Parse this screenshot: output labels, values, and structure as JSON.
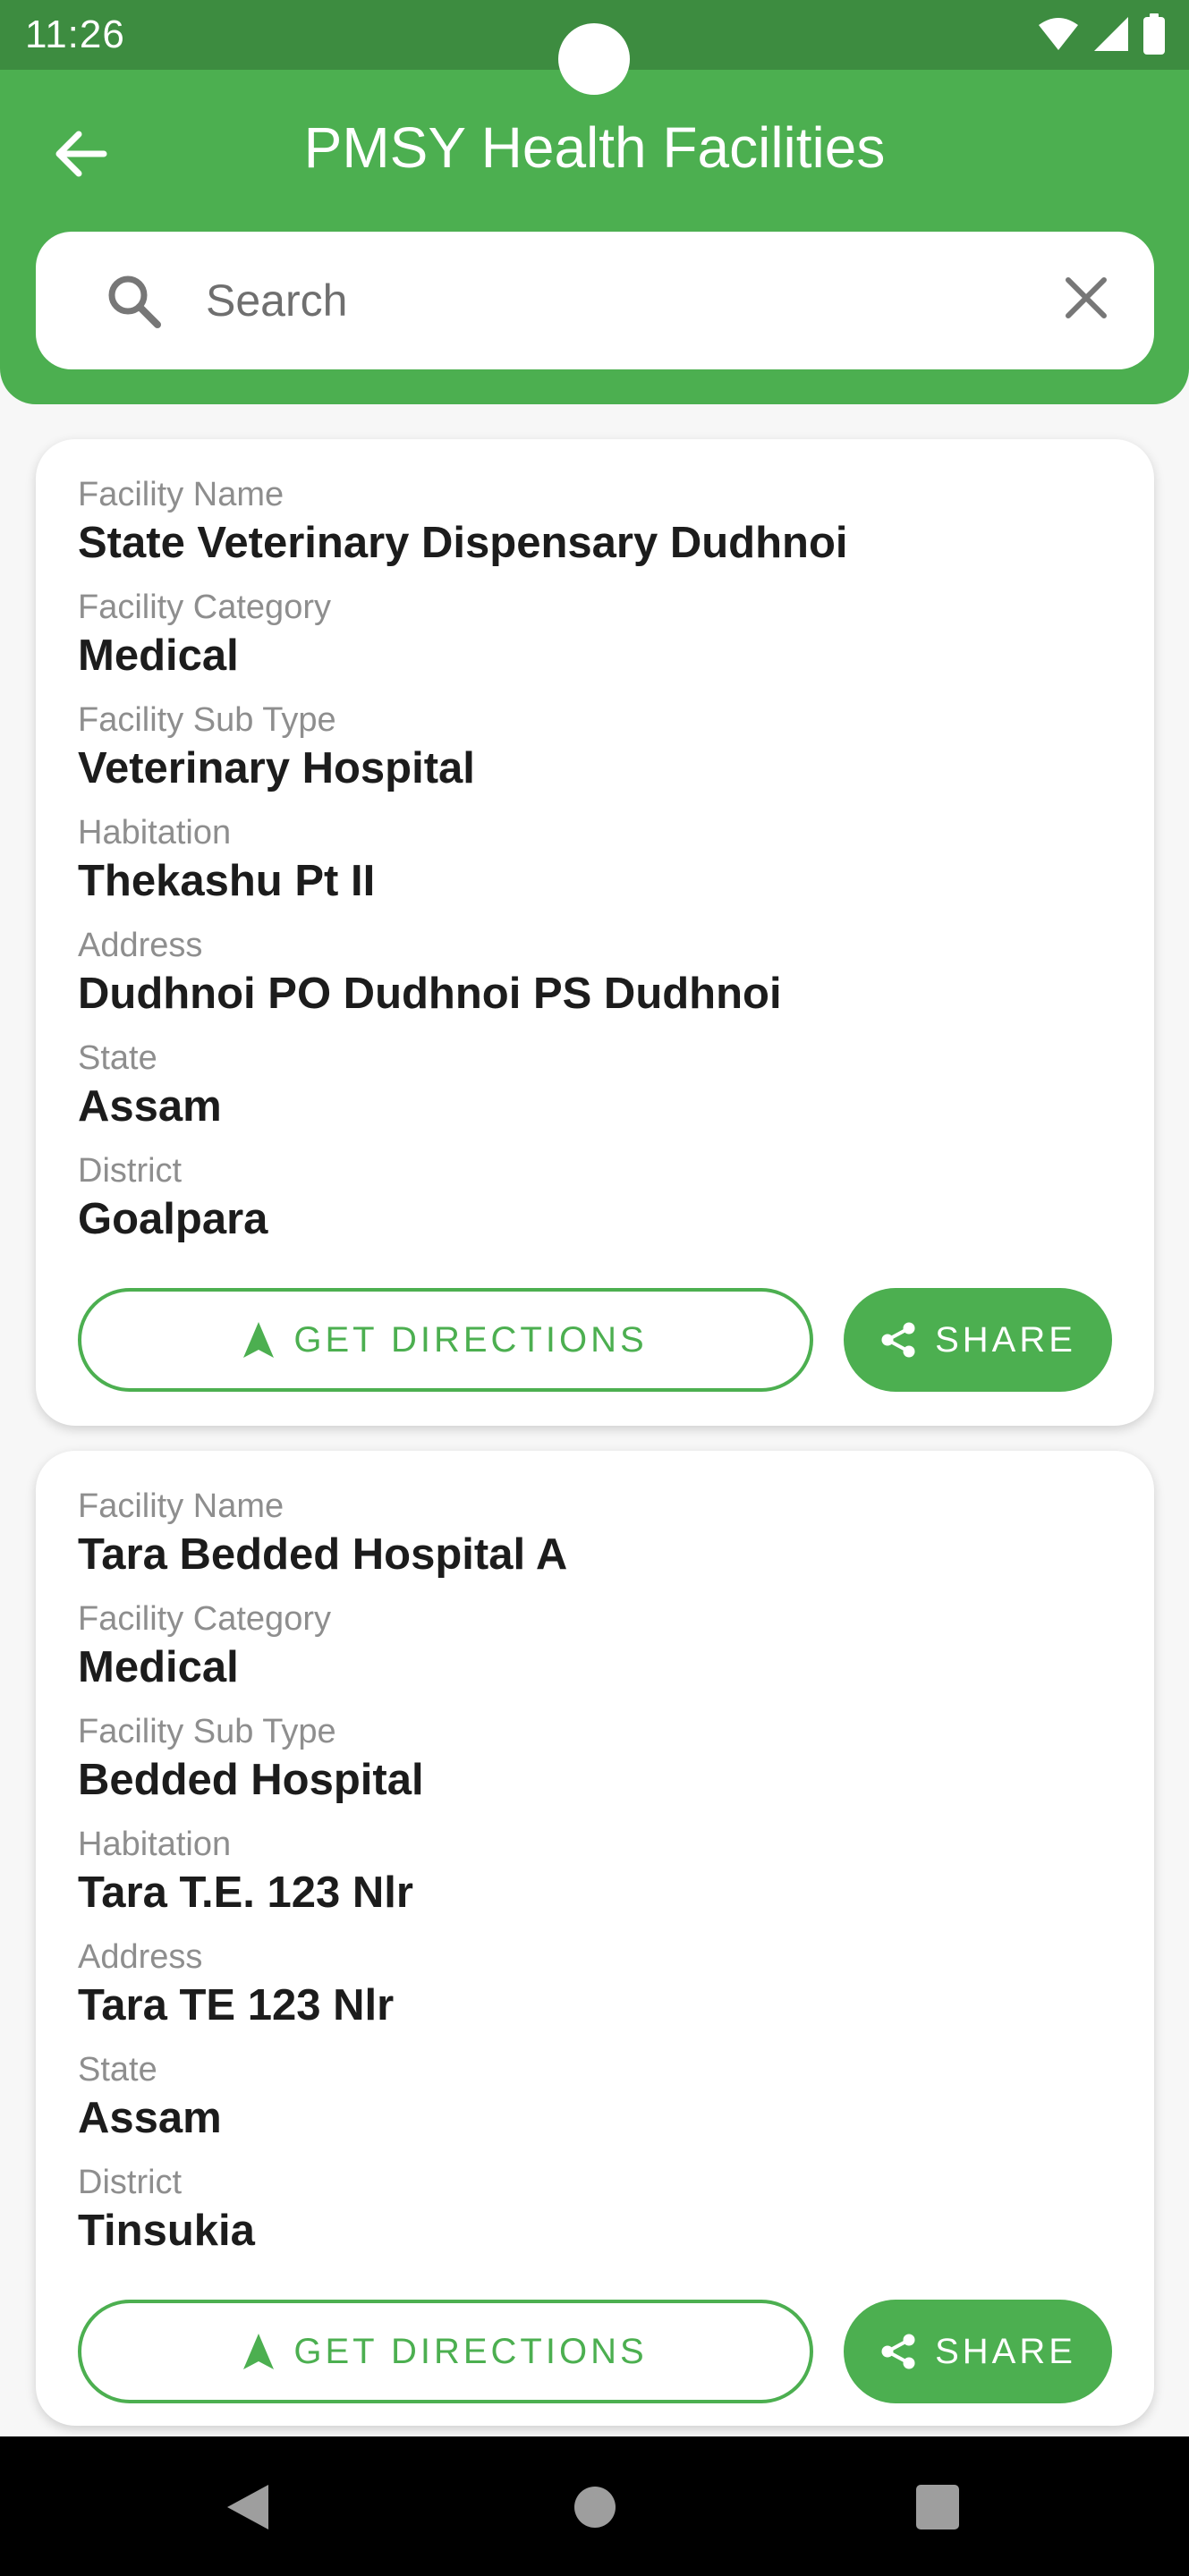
{
  "status_bar": {
    "time": "11:26",
    "icons": [
      "wifi-icon",
      "signal-icon",
      "battery-icon"
    ]
  },
  "app_bar": {
    "title": "PMSY Health Facilities",
    "back_icon": "arrow-back-icon"
  },
  "search": {
    "placeholder": "Search",
    "value": "",
    "search_icon": "search-icon",
    "clear_icon": "close-icon"
  },
  "colors": {
    "primary": "#4caf50",
    "status_bar": "#3d8c40",
    "background": "#f7f7f7",
    "label": "#8e8e8e",
    "value": "#1c1c1c"
  },
  "facilities": [
    {
      "fields": [
        {
          "label": "Facility Name",
          "value": "State Veterinary Dispensary Dudhnoi"
        },
        {
          "label": "Facility Category",
          "value": "Medical"
        },
        {
          "label": "Facility Sub Type",
          "value": "Veterinary Hospital"
        },
        {
          "label": "Habitation",
          "value": "Thekashu Pt II"
        },
        {
          "label": "Address",
          "value": "Dudhnoi PO Dudhnoi PS Dudhnoi"
        },
        {
          "label": "State",
          "value": "Assam"
        },
        {
          "label": "District",
          "value": "Goalpara"
        }
      ],
      "directions_label": "GET DIRECTIONS",
      "share_label": "SHARE"
    },
    {
      "fields": [
        {
          "label": "Facility Name",
          "value": "Tara Bedded Hospital A"
        },
        {
          "label": "Facility Category",
          "value": "Medical"
        },
        {
          "label": "Facility Sub Type",
          "value": "Bedded Hospital"
        },
        {
          "label": "Habitation",
          "value": "Tara T.E. 123 Nlr"
        },
        {
          "label": "Address",
          "value": "Tara TE 123 Nlr"
        },
        {
          "label": "State",
          "value": "Assam"
        },
        {
          "label": "District",
          "value": "Tinsukia"
        }
      ],
      "directions_label": "GET DIRECTIONS",
      "share_label": "SHARE"
    }
  ],
  "nav_bar": {
    "items": [
      "back-nav-icon",
      "home-nav-icon",
      "recents-nav-icon"
    ]
  }
}
